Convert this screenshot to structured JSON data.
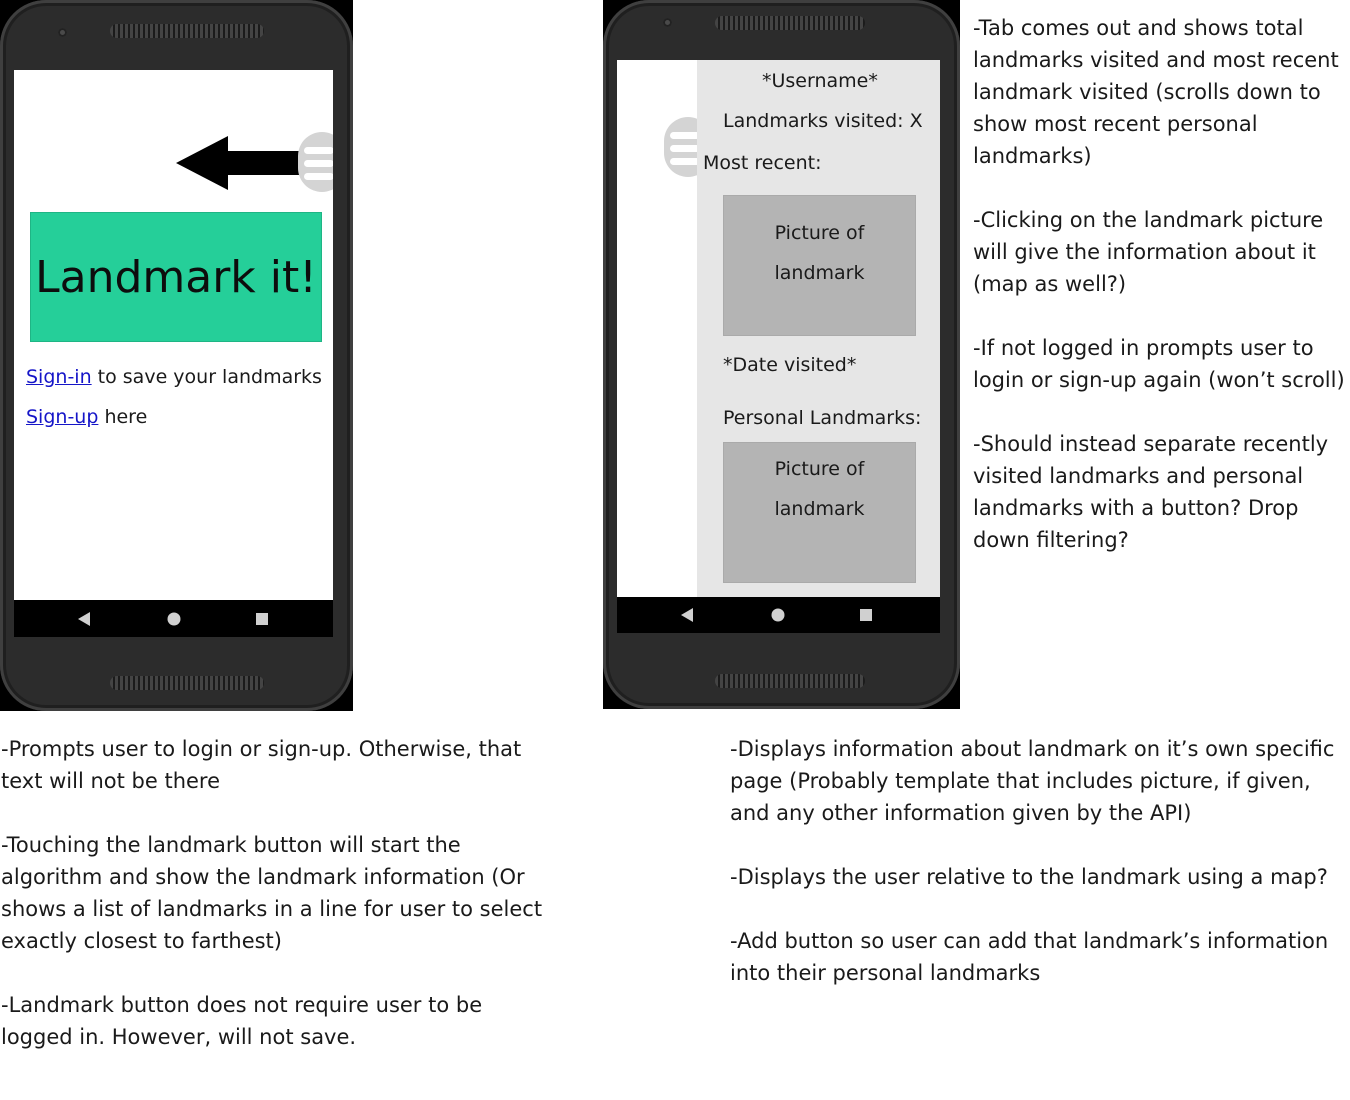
{
  "left_phone": {
    "title": "Landmark it!",
    "signin_link": "Sign-in",
    "signin_rest": " to save your landmarks",
    "signup_link": "Sign-up",
    "signup_rest": " here"
  },
  "right_phone": {
    "username": "*Username*",
    "visited": "Landmarks visited: X",
    "most_recent": "Most recent:",
    "picture_line1": "Picture of",
    "picture_line2": "landmark",
    "date_visited": "*Date visited*",
    "personal": "Personal Landmarks:",
    "picture2_line1": "Picture of",
    "picture2_line2": "landmark"
  },
  "notes": {
    "top_right": [
      "-Tab comes out and shows total landmarks visited and most recent landmark visited (scrolls down to show most recent personal landmarks)",
      "-Clicking on the landmark picture will give the information about it (map as well?)",
      "-If not logged in prompts user to login or sign-up again (won’t scroll)",
      "-Should instead separate recently visited landmarks and personal landmarks with a button? Drop down filtering?"
    ],
    "bottom_left": [
      "-Prompts user to login or sign-up. Otherwise, that text will not be there",
      "-Touching the landmark button will start the algorithm and show the landmark information (Or shows a list of landmarks in a line for user to select exactly closest to farthest)",
      "-Landmark button does not require user to be logged in. However, will not save."
    ],
    "bottom_right": [
      "-Displays information about landmark on it’s own specific page (Probably template that includes picture, if given, and any other information given by the API)",
      "-Displays the user relative to the landmark using a map?",
      "-Add button so user can add that landmark’s information into their personal landmarks"
    ]
  },
  "colors": {
    "accent": "#25cf99",
    "link": "#1515c8",
    "drawer": "#e6e6e6",
    "picture": "#b4b4b4"
  }
}
